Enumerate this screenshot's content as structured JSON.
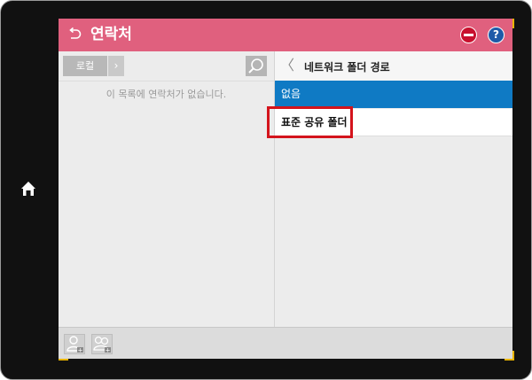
{
  "header": {
    "title": "연락처"
  },
  "left_panel": {
    "local_label": "로컬",
    "empty_message": "이 목록에 연락처가 없습니다."
  },
  "right_panel": {
    "title": "네트워크 폴더 경로",
    "options": [
      {
        "label": "없음",
        "selected": true
      },
      {
        "label": "표준 공유 폴더",
        "selected": false
      }
    ]
  },
  "colors": {
    "title_bar": "#e0607e",
    "selected_row": "#0f7ac4",
    "highlight_box": "#d4141c"
  }
}
